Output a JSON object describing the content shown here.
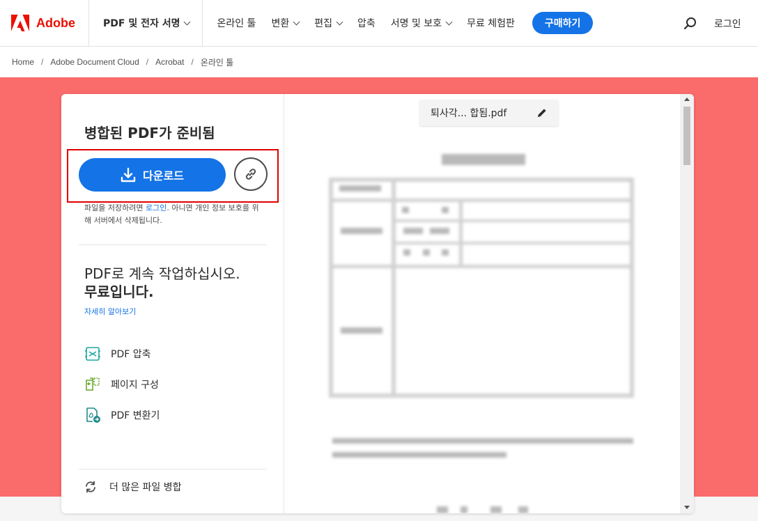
{
  "brand": {
    "name": "Adobe",
    "color": "#eb1000"
  },
  "nav": {
    "primary": "PDF 및 전자 서명",
    "items": [
      {
        "label": "온라인 툴",
        "dropdown": false
      },
      {
        "label": "변환",
        "dropdown": true
      },
      {
        "label": "편집",
        "dropdown": true
      },
      {
        "label": "압축",
        "dropdown": false
      },
      {
        "label": "서명 및 보호",
        "dropdown": true
      },
      {
        "label": "무료 체험판",
        "dropdown": false
      }
    ],
    "buy_label": "구매하기",
    "login_label": "로그인",
    "search_icon": "search-icon"
  },
  "breadcrumb": [
    "Home",
    "Adobe Document Cloud",
    "Acrobat",
    "온라인 툴"
  ],
  "panel": {
    "title": "병합된 PDF가 준비됨",
    "download_label": "다운로드",
    "save_note_before": "파일을 저장하려면 ",
    "save_note_link": "로그인",
    "save_note_after": ". 아니면 개인 정보 보호를 위해 서버에서 삭제됩니다.",
    "promo_line1": "PDF로 계속 작업하십시오.",
    "promo_line2": "무료입니다.",
    "learn_more": "자세히 알아보기",
    "tools": [
      {
        "label": "PDF 압축",
        "icon": "compress-pdf-icon"
      },
      {
        "label": "페이지 구성",
        "icon": "organize-pages-icon"
      },
      {
        "label": "PDF 변환기",
        "icon": "convert-pdf-icon"
      }
    ],
    "merge_more": "더 많은 파일 병합"
  },
  "preview": {
    "filename": "퇴사각... 합됨.pdf"
  },
  "colors": {
    "accent": "#1473e6",
    "hero_bg": "#fa6b6b",
    "highlight": "#e00000"
  }
}
